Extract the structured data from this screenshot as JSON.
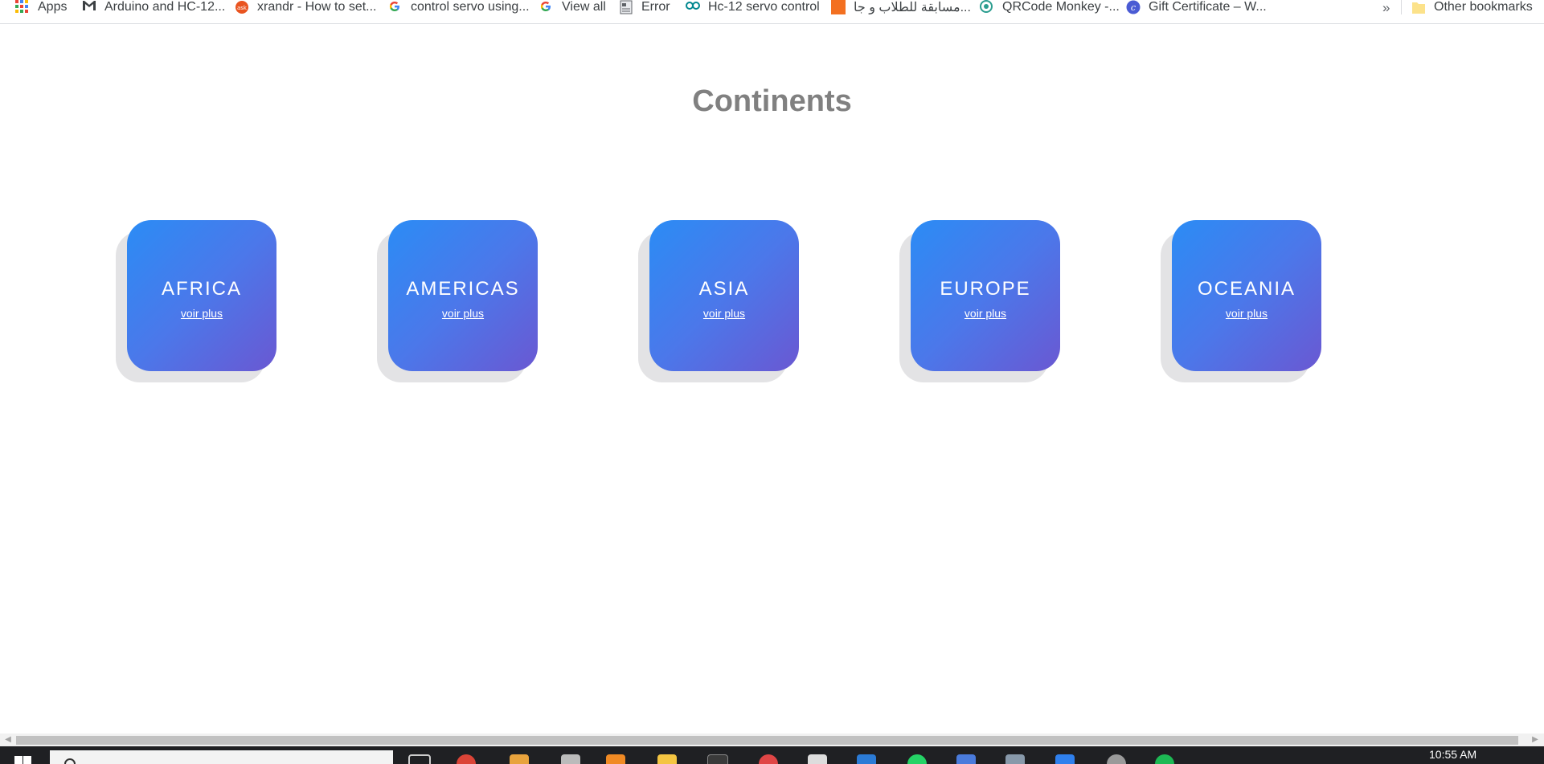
{
  "bookmarks": {
    "items": [
      {
        "label": "Apps",
        "icon": "apps-grid-icon"
      },
      {
        "label": "Arduino and HC-12...",
        "icon": "gmail-icon"
      },
      {
        "label": "xrandr - How to set...",
        "icon": "askubuntu-icon"
      },
      {
        "label": "control servo using...",
        "icon": "google-icon"
      },
      {
        "label": "View all",
        "icon": "google-icon"
      },
      {
        "label": "Error",
        "icon": "page-icon"
      },
      {
        "label": "Hc-12 servo control",
        "icon": "arduino-icon"
      },
      {
        "label": "مسابقة للطلاب و جا...",
        "icon": "orange-site-icon"
      },
      {
        "label": "QRCode Monkey -...",
        "icon": "qrcode-monkey-icon"
      },
      {
        "label": "Gift Certificate – W...",
        "icon": "circle-c-icon"
      }
    ],
    "overflow": "»",
    "other_bookmarks": "Other bookmarks"
  },
  "page": {
    "title": "Continents",
    "cards": [
      {
        "name": "AFRICA",
        "link": "voir plus"
      },
      {
        "name": "AMERICAS",
        "link": "voir plus"
      },
      {
        "name": "ASIA",
        "link": "voir plus"
      },
      {
        "name": "EUROPE",
        "link": "voir plus"
      },
      {
        "name": "OCEANIA",
        "link": "voir plus"
      }
    ]
  },
  "scrollbar": {
    "left_arrow": "◀",
    "right_arrow": "▶"
  },
  "taskbar": {
    "time": "10:55 AM"
  },
  "colors": {
    "card_gradient_start": "#2b8cf5",
    "card_gradient_end": "#6a58d2",
    "title": "#808080",
    "card_shadow": "#e3e3e5"
  }
}
